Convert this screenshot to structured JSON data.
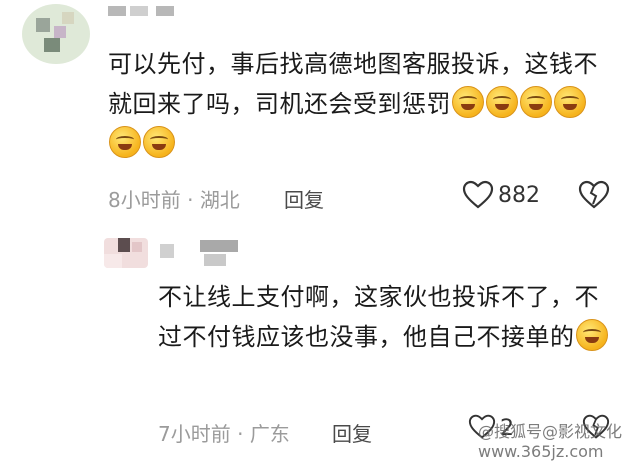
{
  "comment1": {
    "username": "",
    "text": "可以先付，事后找高德地图客服投诉，这钱不就回来了吗，司机还会受到惩罚",
    "time": "8小时前",
    "location": "湖北",
    "reply_label": "回复",
    "like_count": "882",
    "emoji_count": 6
  },
  "comment2": {
    "username": "",
    "text": "不让线上支付啊，这家伙也投诉不了，不过不付钱应该也没事，他自己不接单的",
    "time": "7小时前",
    "location": "广东",
    "reply_label": "回复",
    "like_count": "2",
    "emoji_count": 1
  },
  "separator": " · ",
  "watermark": "@搜狐号@影视文化  www.365jz.com",
  "icons": {
    "like": "heart-outline-icon",
    "dislike": "broken-heart-icon",
    "emoji": "grin-emoji-icon"
  },
  "colors": {
    "text": "#1a1a1a",
    "meta": "#9b9b9b",
    "emoji": "#f6b31c"
  }
}
